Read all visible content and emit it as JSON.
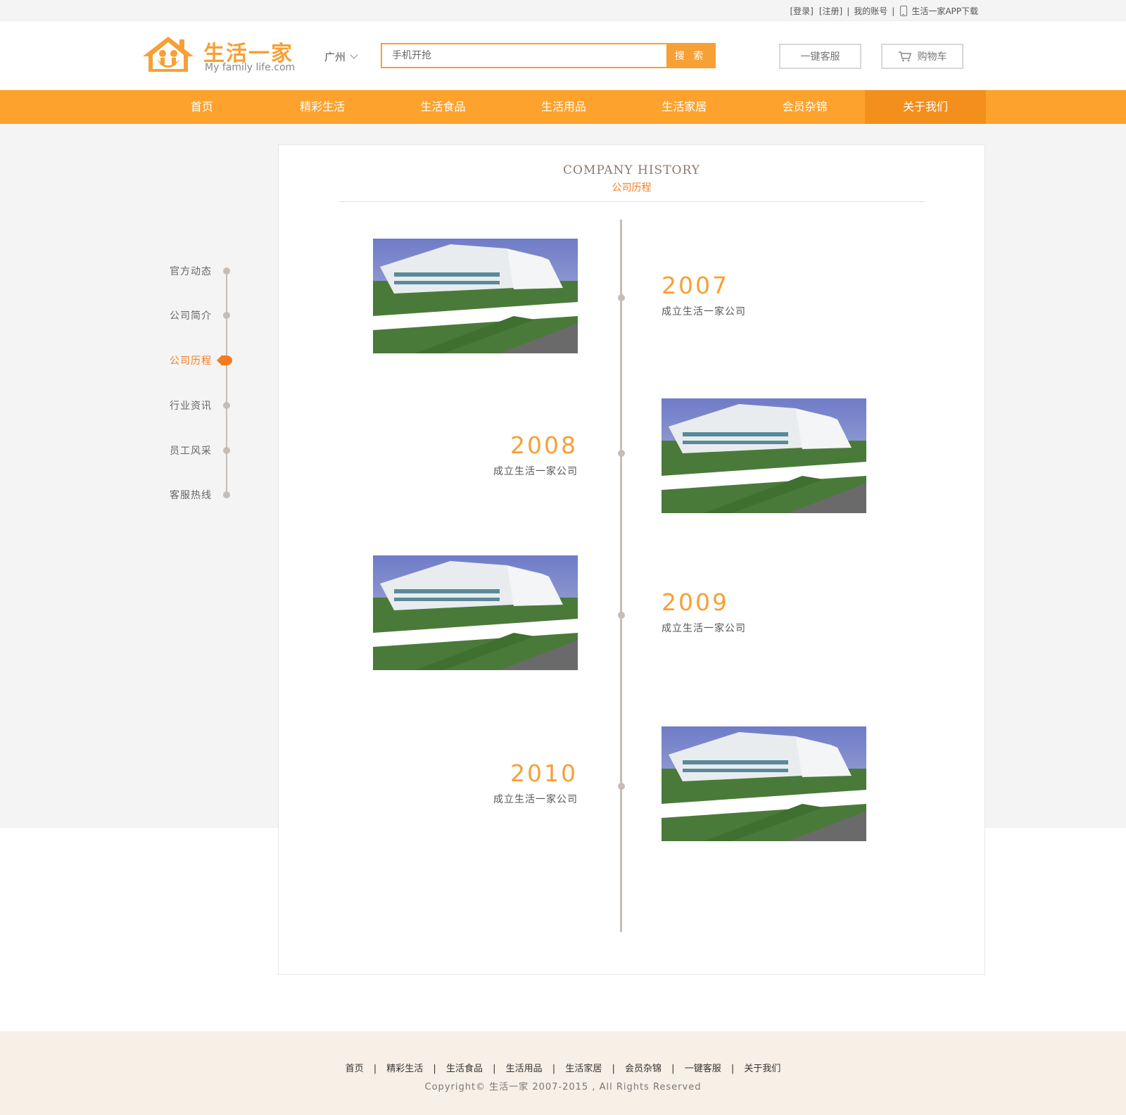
{
  "topbar": {
    "login": "[登录]",
    "register": "[注册]",
    "sep1": "|",
    "account": "我的账号",
    "sep2": "|",
    "app_download": "生活一家APP下载"
  },
  "logo": {
    "title": "生活一家",
    "subtitle": "My family life.com"
  },
  "city": "广州",
  "search": {
    "placeholder": "手机开抢",
    "button": "搜 索"
  },
  "header_buttons": {
    "service": "一键客服",
    "cart": "购物车"
  },
  "nav": {
    "items": [
      "首页",
      "精彩生活",
      "生活食品",
      "生活用品",
      "生活家居",
      "会员杂锦",
      "关于我们"
    ],
    "active_index": 6
  },
  "sidebar": {
    "items": [
      "官方动态",
      "公司简介",
      "公司历程",
      "行业资讯",
      "员工风采",
      "客服热线"
    ],
    "active_index": 2
  },
  "panel": {
    "title": "COMPANY  HISTORY",
    "subtitle": "公司历程"
  },
  "timeline": [
    {
      "year": "2007",
      "text": "成立生活一家公司"
    },
    {
      "year": "2008",
      "text": "成立生活一家公司"
    },
    {
      "year": "2009",
      "text": "成立生活一家公司"
    },
    {
      "year": "2010",
      "text": "成立生活一家公司"
    }
  ],
  "footer": {
    "links": [
      "首页",
      "精彩生活",
      "生活食品",
      "生活用品",
      "生活家居",
      "会员杂锦",
      "一键客服",
      "关于我们"
    ],
    "separator": "|",
    "copyright": "Copyright© 生活一家 2007-2015 , All Rights Reserved"
  },
  "colors": {
    "brand": "#f7a035",
    "nav": "#fda22d",
    "nav_active": "#f38f1c",
    "accent": "#f47a20",
    "timeline": "#c7bdb5",
    "footer_bg": "#f8efe6"
  },
  "icons": {
    "phone": "phone-icon",
    "chevron": "chevron-down-icon",
    "cart": "cart-icon",
    "logo": "house-family-icon"
  }
}
